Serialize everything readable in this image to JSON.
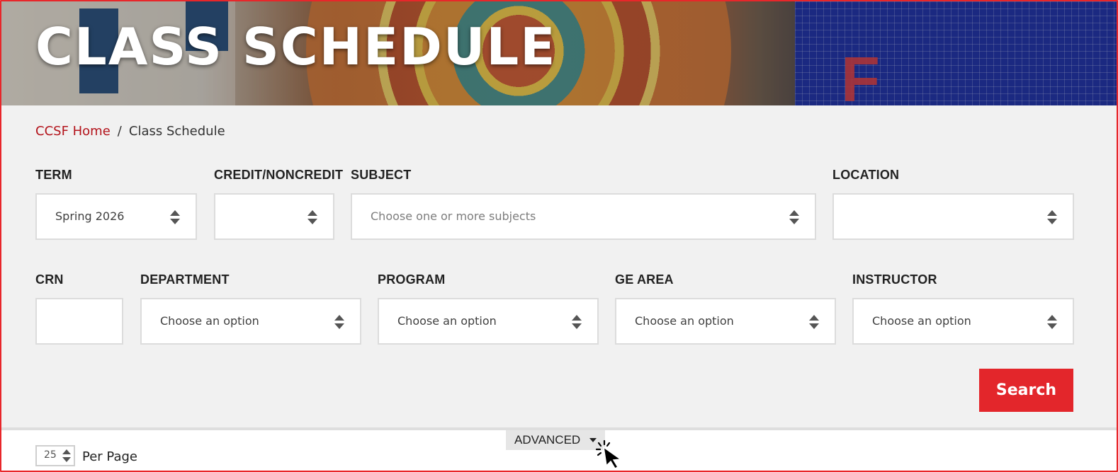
{
  "header": {
    "title": "CLASS SCHEDULE"
  },
  "breadcrumb": {
    "home": "CCSF Home",
    "separator": "/",
    "current": "Class Schedule"
  },
  "filters": {
    "term": {
      "label": "TERM",
      "value": "Spring 2026"
    },
    "credit": {
      "label": "CREDIT/NONCREDIT",
      "value": ""
    },
    "subject": {
      "label": "SUBJECT",
      "placeholder": "Choose one or more subjects"
    },
    "location": {
      "label": "LOCATION",
      "value": ""
    },
    "crn": {
      "label": "CRN",
      "value": ""
    },
    "department": {
      "label": "DEPARTMENT",
      "placeholder": "Choose an option"
    },
    "program": {
      "label": "PROGRAM",
      "placeholder": "Choose an option"
    },
    "ge_area": {
      "label": "GE AREA",
      "placeholder": "Choose an option"
    },
    "instructor": {
      "label": "INSTRUCTOR",
      "placeholder": "Choose an option"
    }
  },
  "actions": {
    "search_label": "Search",
    "advanced_label": "ADVANCED"
  },
  "pagination": {
    "per_page_value": "25",
    "per_page_label": "Per Page"
  },
  "colors": {
    "accent": "#e3262b",
    "link": "#b3131b",
    "panel_bg": "#f1f1f1"
  },
  "icons": [
    "updown-arrows-icon",
    "caret-down-icon",
    "pointer-cursor-icon"
  ]
}
